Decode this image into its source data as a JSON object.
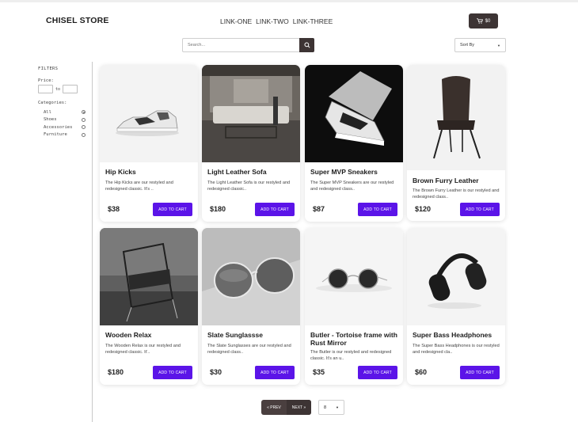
{
  "header": {
    "brand": "CHISEL STORE",
    "nav": [
      "LINK-ONE",
      "LINK-TWO",
      "LINK-THREE"
    ],
    "cart_label": "$0"
  },
  "search": {
    "placeholder": "Search...",
    "value": ""
  },
  "sort": {
    "selected": "Sort By"
  },
  "filters": {
    "title": "FILTERS",
    "price_label": "Price:",
    "price_min": "",
    "price_max": "",
    "to_label": "to",
    "categories_label": "Categories:",
    "categories": [
      {
        "label": "All",
        "checked": true
      },
      {
        "label": "Shoes",
        "checked": false
      },
      {
        "label": "Accessories",
        "checked": false
      },
      {
        "label": "Furniture",
        "checked": false
      }
    ]
  },
  "products": [
    {
      "title": "Hip Kicks",
      "desc": "The Hip Kicks are our restyled and redesigned classic. It's ..",
      "price": "$38",
      "cta": "ADD TO CART"
    },
    {
      "title": "Light Leather Sofa",
      "desc": "The Light Leather Sofa is our restyled and redesigned classic..",
      "price": "$180",
      "cta": "ADD TO CART"
    },
    {
      "title": "Super MVP Sneakers",
      "desc": "The Super MVP Sneakers are our restyled and redesigned class..",
      "price": "$87",
      "cta": "ADD TO CART"
    },
    {
      "title": "Brown Furry Leather",
      "desc": "The Brown Furry Leather is our restyled and redesigned class..",
      "price": "$120",
      "cta": "ADD TO CART"
    },
    {
      "title": "Wooden Relax",
      "desc": "The Wooden Relax is our restyled and redesigned classic. It'..",
      "price": "$180",
      "cta": "ADD TO CART"
    },
    {
      "title": "Slate Sunglassse",
      "desc": "The Slate Sunglasses are our restyled and redesigned class..",
      "price": "$30",
      "cta": "ADD TO CART"
    },
    {
      "title": "Butler - Tortoise frame with Rust Mirror",
      "desc": "The Butler is our restyled and redesigned classic. It's an u..",
      "price": "$35",
      "cta": "ADD TO CART"
    },
    {
      "title": "Super Bass Headphones",
      "desc": "The Super Bass Headphones is our restyled and redesigned cla..",
      "price": "$60",
      "cta": "ADD TO CART"
    }
  ],
  "pagination": {
    "prev": "« PREV",
    "next": "NEXT »",
    "per_page": "8"
  },
  "colors": {
    "accent": "#5b14e8",
    "dark": "#3d3434"
  }
}
